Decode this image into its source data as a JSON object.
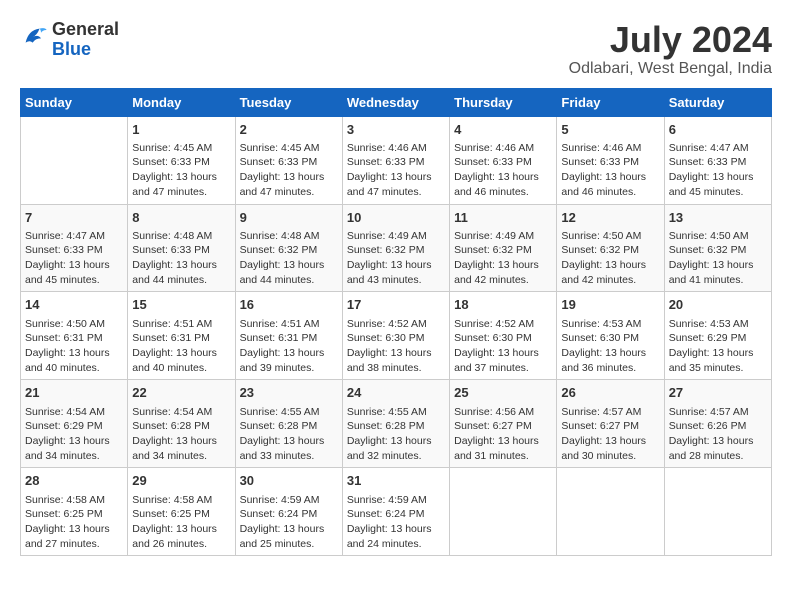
{
  "header": {
    "logo_line1": "General",
    "logo_line2": "Blue",
    "month_year": "July 2024",
    "location": "Odlabari, West Bengal, India"
  },
  "weekdays": [
    "Sunday",
    "Monday",
    "Tuesday",
    "Wednesday",
    "Thursday",
    "Friday",
    "Saturday"
  ],
  "weeks": [
    [
      {
        "day": "",
        "sunrise": "",
        "sunset": "",
        "daylight": ""
      },
      {
        "day": "1",
        "sunrise": "Sunrise: 4:45 AM",
        "sunset": "Sunset: 6:33 PM",
        "daylight": "Daylight: 13 hours and 47 minutes."
      },
      {
        "day": "2",
        "sunrise": "Sunrise: 4:45 AM",
        "sunset": "Sunset: 6:33 PM",
        "daylight": "Daylight: 13 hours and 47 minutes."
      },
      {
        "day": "3",
        "sunrise": "Sunrise: 4:46 AM",
        "sunset": "Sunset: 6:33 PM",
        "daylight": "Daylight: 13 hours and 47 minutes."
      },
      {
        "day": "4",
        "sunrise": "Sunrise: 4:46 AM",
        "sunset": "Sunset: 6:33 PM",
        "daylight": "Daylight: 13 hours and 46 minutes."
      },
      {
        "day": "5",
        "sunrise": "Sunrise: 4:46 AM",
        "sunset": "Sunset: 6:33 PM",
        "daylight": "Daylight: 13 hours and 46 minutes."
      },
      {
        "day": "6",
        "sunrise": "Sunrise: 4:47 AM",
        "sunset": "Sunset: 6:33 PM",
        "daylight": "Daylight: 13 hours and 45 minutes."
      }
    ],
    [
      {
        "day": "7",
        "sunrise": "Sunrise: 4:47 AM",
        "sunset": "Sunset: 6:33 PM",
        "daylight": "Daylight: 13 hours and 45 minutes."
      },
      {
        "day": "8",
        "sunrise": "Sunrise: 4:48 AM",
        "sunset": "Sunset: 6:33 PM",
        "daylight": "Daylight: 13 hours and 44 minutes."
      },
      {
        "day": "9",
        "sunrise": "Sunrise: 4:48 AM",
        "sunset": "Sunset: 6:32 PM",
        "daylight": "Daylight: 13 hours and 44 minutes."
      },
      {
        "day": "10",
        "sunrise": "Sunrise: 4:49 AM",
        "sunset": "Sunset: 6:32 PM",
        "daylight": "Daylight: 13 hours and 43 minutes."
      },
      {
        "day": "11",
        "sunrise": "Sunrise: 4:49 AM",
        "sunset": "Sunset: 6:32 PM",
        "daylight": "Daylight: 13 hours and 42 minutes."
      },
      {
        "day": "12",
        "sunrise": "Sunrise: 4:50 AM",
        "sunset": "Sunset: 6:32 PM",
        "daylight": "Daylight: 13 hours and 42 minutes."
      },
      {
        "day": "13",
        "sunrise": "Sunrise: 4:50 AM",
        "sunset": "Sunset: 6:32 PM",
        "daylight": "Daylight: 13 hours and 41 minutes."
      }
    ],
    [
      {
        "day": "14",
        "sunrise": "Sunrise: 4:50 AM",
        "sunset": "Sunset: 6:31 PM",
        "daylight": "Daylight: 13 hours and 40 minutes."
      },
      {
        "day": "15",
        "sunrise": "Sunrise: 4:51 AM",
        "sunset": "Sunset: 6:31 PM",
        "daylight": "Daylight: 13 hours and 40 minutes."
      },
      {
        "day": "16",
        "sunrise": "Sunrise: 4:51 AM",
        "sunset": "Sunset: 6:31 PM",
        "daylight": "Daylight: 13 hours and 39 minutes."
      },
      {
        "day": "17",
        "sunrise": "Sunrise: 4:52 AM",
        "sunset": "Sunset: 6:30 PM",
        "daylight": "Daylight: 13 hours and 38 minutes."
      },
      {
        "day": "18",
        "sunrise": "Sunrise: 4:52 AM",
        "sunset": "Sunset: 6:30 PM",
        "daylight": "Daylight: 13 hours and 37 minutes."
      },
      {
        "day": "19",
        "sunrise": "Sunrise: 4:53 AM",
        "sunset": "Sunset: 6:30 PM",
        "daylight": "Daylight: 13 hours and 36 minutes."
      },
      {
        "day": "20",
        "sunrise": "Sunrise: 4:53 AM",
        "sunset": "Sunset: 6:29 PM",
        "daylight": "Daylight: 13 hours and 35 minutes."
      }
    ],
    [
      {
        "day": "21",
        "sunrise": "Sunrise: 4:54 AM",
        "sunset": "Sunset: 6:29 PM",
        "daylight": "Daylight: 13 hours and 34 minutes."
      },
      {
        "day": "22",
        "sunrise": "Sunrise: 4:54 AM",
        "sunset": "Sunset: 6:28 PM",
        "daylight": "Daylight: 13 hours and 34 minutes."
      },
      {
        "day": "23",
        "sunrise": "Sunrise: 4:55 AM",
        "sunset": "Sunset: 6:28 PM",
        "daylight": "Daylight: 13 hours and 33 minutes."
      },
      {
        "day": "24",
        "sunrise": "Sunrise: 4:55 AM",
        "sunset": "Sunset: 6:28 PM",
        "daylight": "Daylight: 13 hours and 32 minutes."
      },
      {
        "day": "25",
        "sunrise": "Sunrise: 4:56 AM",
        "sunset": "Sunset: 6:27 PM",
        "daylight": "Daylight: 13 hours and 31 minutes."
      },
      {
        "day": "26",
        "sunrise": "Sunrise: 4:57 AM",
        "sunset": "Sunset: 6:27 PM",
        "daylight": "Daylight: 13 hours and 30 minutes."
      },
      {
        "day": "27",
        "sunrise": "Sunrise: 4:57 AM",
        "sunset": "Sunset: 6:26 PM",
        "daylight": "Daylight: 13 hours and 28 minutes."
      }
    ],
    [
      {
        "day": "28",
        "sunrise": "Sunrise: 4:58 AM",
        "sunset": "Sunset: 6:25 PM",
        "daylight": "Daylight: 13 hours and 27 minutes."
      },
      {
        "day": "29",
        "sunrise": "Sunrise: 4:58 AM",
        "sunset": "Sunset: 6:25 PM",
        "daylight": "Daylight: 13 hours and 26 minutes."
      },
      {
        "day": "30",
        "sunrise": "Sunrise: 4:59 AM",
        "sunset": "Sunset: 6:24 PM",
        "daylight": "Daylight: 13 hours and 25 minutes."
      },
      {
        "day": "31",
        "sunrise": "Sunrise: 4:59 AM",
        "sunset": "Sunset: 6:24 PM",
        "daylight": "Daylight: 13 hours and 24 minutes."
      },
      {
        "day": "",
        "sunrise": "",
        "sunset": "",
        "daylight": ""
      },
      {
        "day": "",
        "sunrise": "",
        "sunset": "",
        "daylight": ""
      },
      {
        "day": "",
        "sunrise": "",
        "sunset": "",
        "daylight": ""
      }
    ]
  ]
}
